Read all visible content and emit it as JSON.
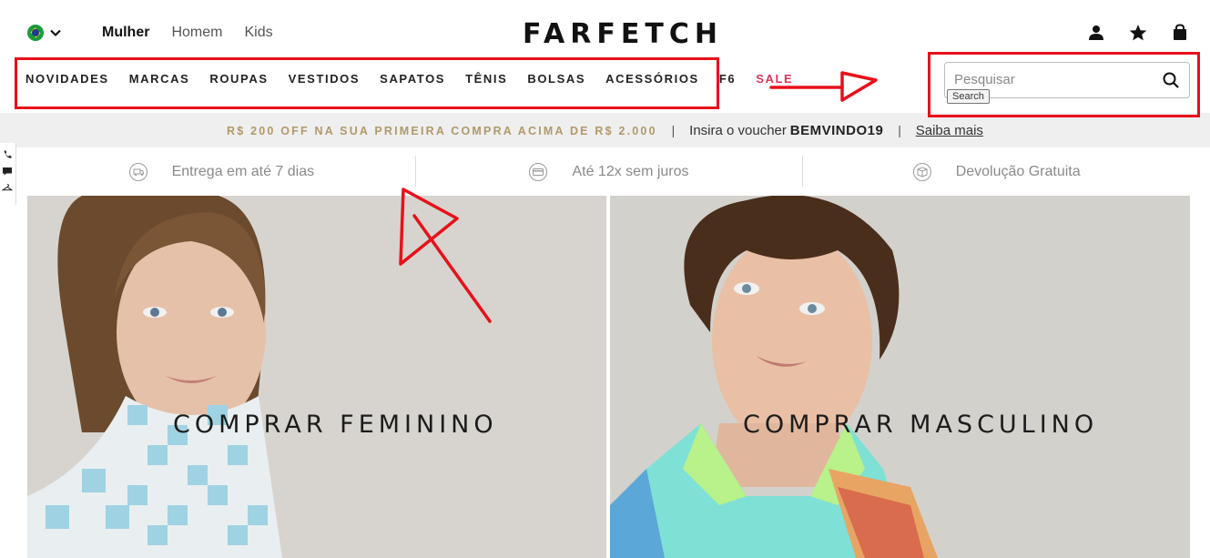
{
  "header": {
    "logo": "FARFETCH",
    "gender_nav": [
      "Mulher",
      "Homem",
      "Kids"
    ],
    "region_icon": "brazil-flag-icon",
    "account_icons": [
      "user-icon",
      "star-icon",
      "shopping-bag-icon"
    ]
  },
  "categories": [
    "NOVIDADES",
    "MARCAS",
    "ROUPAS",
    "VESTIDOS",
    "SAPATOS",
    "TÊNIS",
    "BOLSAS",
    "ACESSÓRIOS",
    "F6",
    "SALE"
  ],
  "search": {
    "placeholder": "Pesquisar",
    "tooltip": "Search",
    "icon": "search-icon"
  },
  "promo": {
    "offer": "R$ 200 OFF NA SUA PRIMEIRA COMPRA ACIMA DE R$ 2.000",
    "separator": "|",
    "voucher_prefix": "Insira o voucher",
    "voucher_code": "BEMVINDO19",
    "link": "Saiba mais"
  },
  "benefits": [
    {
      "icon": "delivery-icon",
      "label": "Entrega em até 7 dias"
    },
    {
      "icon": "credit-card-icon",
      "label": "Até 12x sem juros"
    },
    {
      "icon": "return-box-icon",
      "label": "Devolução Gratuita"
    }
  ],
  "side_tools": [
    "phone-icon",
    "chat-icon",
    "hanger-icon"
  ],
  "heroes": {
    "women": "COMPRAR FEMININO",
    "men": "COMPRAR MASCULINO"
  },
  "colors": {
    "sale": "#d8365a",
    "promo_gold": "#b0996a",
    "annotation_red": "#e8101a",
    "promo_bg": "#efefef"
  }
}
